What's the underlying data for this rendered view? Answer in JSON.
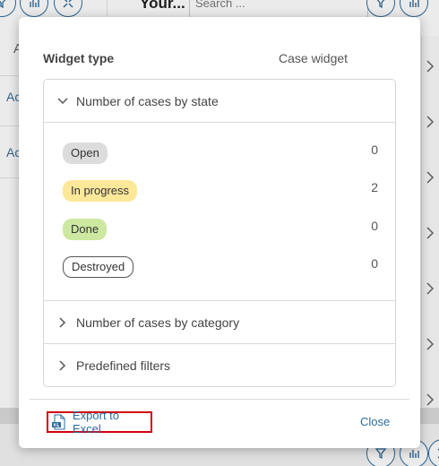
{
  "background": {
    "title": "Your...",
    "search_placeholder": "Search ...",
    "left_letter": "A",
    "left_links": [
      "Ac",
      "Ac"
    ]
  },
  "modal": {
    "widget_type_label": "Widget type",
    "widget_type_value": "Case widget",
    "sections": [
      {
        "label": "Number of cases by state",
        "expanded": true
      },
      {
        "label": "Number of cases by category",
        "expanded": false
      },
      {
        "label": "Predefined filters",
        "expanded": false
      }
    ],
    "states": [
      {
        "label": "Open",
        "count": "0",
        "color": "#dcdcdc"
      },
      {
        "label": "In progress",
        "count": "2",
        "color": "#fde89a"
      },
      {
        "label": "Done",
        "count": "0",
        "color": "#cde8a0"
      },
      {
        "label": "Destroyed",
        "count": "0",
        "color": "#ffffff"
      }
    ],
    "footer": {
      "export_label": "Export to Excel",
      "close_label": "Close"
    }
  },
  "colors": {
    "accent": "#2b6b9e",
    "highlight_border": "#d4000f"
  }
}
